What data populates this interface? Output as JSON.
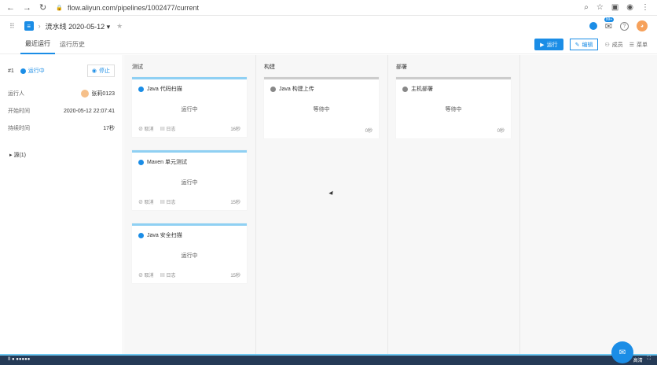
{
  "browser": {
    "url": "flow.aliyun.com/pipelines/1002477/current",
    "badge": "99+"
  },
  "app": {
    "pipeline_name": "流水线 2020-05-12 ▾"
  },
  "tabs": [
    "最近运行",
    "运行历史"
  ],
  "actions": {
    "run": "运行",
    "edit": "编辑",
    "members": "成员",
    "menu": "菜单"
  },
  "run": {
    "number": "#1",
    "status": "运行中",
    "stop": "停止",
    "runner_label": "运行人",
    "runner": "张莉0123",
    "start_label": "开始时间",
    "start": "2020-05-12 22:07:41",
    "duration_label": "持续时间",
    "duration": "17秒",
    "source": "▸ 源(1)"
  },
  "stages": [
    {
      "name": "测试",
      "jobs": [
        {
          "title": "Java 代码扫描",
          "status": "运行中",
          "cancel": "取消",
          "log": "日志",
          "time": "16秒"
        },
        {
          "title": "Maven 单元测试",
          "status": "运行中",
          "cancel": "取消",
          "log": "日志",
          "time": "15秒"
        },
        {
          "title": "Java 安全扫描",
          "status": "运行中",
          "cancel": "取消",
          "log": "日志",
          "time": "15秒"
        }
      ]
    },
    {
      "name": "构建",
      "jobs": [
        {
          "title": "Java 构建上传",
          "status": "等待中",
          "time": "0秒"
        }
      ]
    },
    {
      "name": "部署",
      "jobs": [
        {
          "title": "主机部署",
          "status": "等待中",
          "time": "0秒"
        }
      ]
    }
  ],
  "bottom": {
    "left": "II  ●  ●●●●●",
    "right": "高清"
  }
}
